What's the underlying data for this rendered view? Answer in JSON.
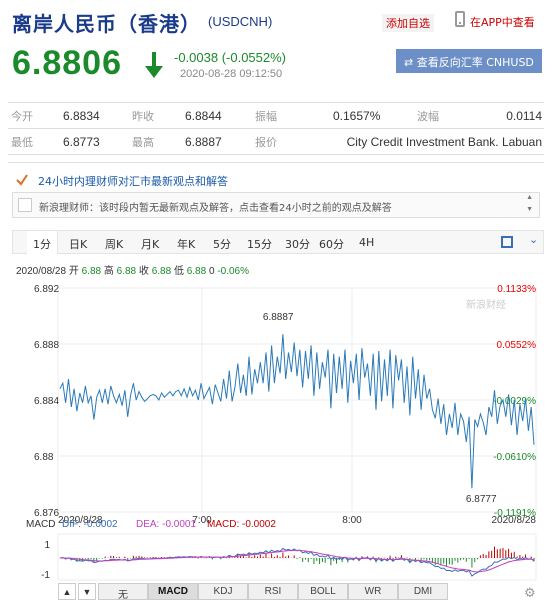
{
  "header": {
    "title": "离岸人民币（香港）",
    "code": "(USDCNH)",
    "add_favorite": "添加自选",
    "view_in_app": "在APP中查看"
  },
  "quote": {
    "price": "6.8806",
    "change": "-0.0038 (-0.0552%)",
    "timestamp": "2020-08-28 09:12:50",
    "reverse_button": "查看反向汇率 CNHUSD",
    "reverse_icon": "swap-arrows-icon"
  },
  "stats": [
    [
      {
        "label": "今开",
        "value": "6.8834"
      },
      {
        "label": "昨收",
        "value": "6.8844"
      },
      {
        "label": "振幅",
        "value": "0.1657%"
      },
      {
        "label": "波幅",
        "value": "0.0114"
      }
    ],
    [
      {
        "label": "最低",
        "value": "6.8773"
      },
      {
        "label": "最高",
        "value": "6.8887"
      },
      {
        "label": "报价",
        "value": "City Credit Investment Bank. Labuan"
      }
    ]
  ],
  "news": {
    "title": "24小时内理财师对汇市最新观点和解答",
    "message": "新浪理财师：该时段内暂无最新观点及解答，点击查看24小时之前的观点及解答"
  },
  "tabs": [
    "1分",
    "日K",
    "周K",
    "月K",
    "年K",
    "5分",
    "15分",
    "30分",
    "60分",
    "4H"
  ],
  "tab_active": "1分",
  "info_line": {
    "date": "2020/08/28",
    "open_label": "开",
    "open": "6.88",
    "high_label": "高",
    "high": "6.88",
    "close_label": "收",
    "close": "6.88",
    "low_label": "低",
    "low": "6.88",
    "volume": "0",
    "change_pct": "-0.06%"
  },
  "chart_data": {
    "type": "line",
    "series": [
      {
        "values": [
          6.8848,
          6.8852,
          6.8838,
          6.8855,
          6.8835,
          6.8848,
          6.8832,
          6.8845,
          6.8838,
          6.885,
          6.8838,
          6.8843,
          6.8826,
          6.8842,
          6.8847,
          6.8838,
          6.8848,
          6.8837,
          6.885,
          6.8843,
          6.8838,
          6.8844,
          6.8836,
          6.8847,
          6.8828,
          6.8843,
          6.8852,
          6.884,
          6.8846,
          6.8842,
          6.8839,
          6.8841,
          6.8843,
          6.8844,
          6.8843,
          6.884,
          6.8845,
          6.8842,
          6.8844,
          6.8846,
          6.8843,
          6.8846,
          6.8847,
          6.8843,
          6.8848,
          6.8842,
          6.8849,
          6.8843,
          6.8847,
          6.884,
          6.8852,
          6.8841,
          6.8845,
          6.8849,
          6.8837,
          6.8851,
          6.8845,
          6.8839,
          6.8855,
          6.8841,
          6.8861,
          6.8839,
          6.8849,
          6.8866,
          6.8845,
          6.8858,
          6.8843,
          6.8871,
          6.8844,
          6.8862,
          6.8852,
          6.8867,
          6.8852,
          6.8874,
          6.8846,
          6.8879,
          6.8852,
          6.8871,
          6.8859,
          6.8887,
          6.8855,
          6.8874,
          6.886,
          6.8881,
          6.8857,
          6.8876,
          6.8849,
          6.8875,
          6.8855,
          6.8879,
          6.8843,
          6.8874,
          6.8848,
          6.8867,
          6.8856,
          6.8876,
          6.8834,
          6.8873,
          6.8845,
          6.8871,
          6.8848,
          6.8876,
          6.8838,
          6.8868,
          6.8852,
          6.8873,
          6.884,
          6.8877,
          6.8856,
          6.8866,
          6.8843,
          6.8873,
          6.8833,
          6.8875,
          6.8839,
          6.8869,
          6.8843,
          6.8876,
          6.8834,
          6.8872,
          6.8854,
          6.8869,
          6.8838,
          6.8864,
          6.8829,
          6.8871,
          6.8841,
          6.8862,
          6.8833,
          6.8858,
          6.8841,
          6.8848,
          6.8833,
          6.8827,
          6.8841,
          6.8823,
          6.8837,
          6.8815,
          6.883,
          6.882,
          6.8838,
          6.8815,
          6.883,
          6.8825,
          6.881,
          6.8828,
          6.8777,
          6.8826,
          6.8821,
          6.883,
          6.8824,
          6.8815,
          6.8835,
          6.8828,
          6.8847,
          6.8823,
          6.8836,
          6.884,
          6.8828,
          6.8844,
          6.8822,
          6.884,
          6.8815,
          6.8837,
          6.8825,
          6.8841,
          6.8818,
          6.8835,
          6.8808
        ]
      }
    ],
    "x_tick_labels": [
      "2020/8/28",
      "7:00",
      "8:00",
      "2020/8/28"
    ],
    "y_ticks": [
      "6.892",
      "6.888",
      "6.884",
      "6.88",
      "6.876"
    ],
    "y_range": [
      6.876,
      6.892
    ],
    "pct_ticks": [
      "0.1133%",
      "0.0552%",
      "-0.0029%",
      "-0.0610%",
      "-0.1191%"
    ],
    "annotations": [
      "6.8887",
      "6.8777"
    ],
    "watermark": "新浪财经",
    "line_color": "#2a7ab8",
    "macd": {
      "label": "MACD",
      "dif_label": "DIF: -0.0002",
      "dea_label": "DEA: -0.0001",
      "macd_label": "MACD: -0.0002",
      "y_ticks": [
        "1",
        "-1"
      ],
      "dif_color": "#3a6db5",
      "dea_color": "#c040c0",
      "macd_color": "#c00000"
    }
  },
  "bottom_tabs": [
    "无",
    "MACD",
    "KDJ",
    "RSI",
    "BOLL",
    "WR",
    "DMI"
  ],
  "bottom_active": "MACD"
}
